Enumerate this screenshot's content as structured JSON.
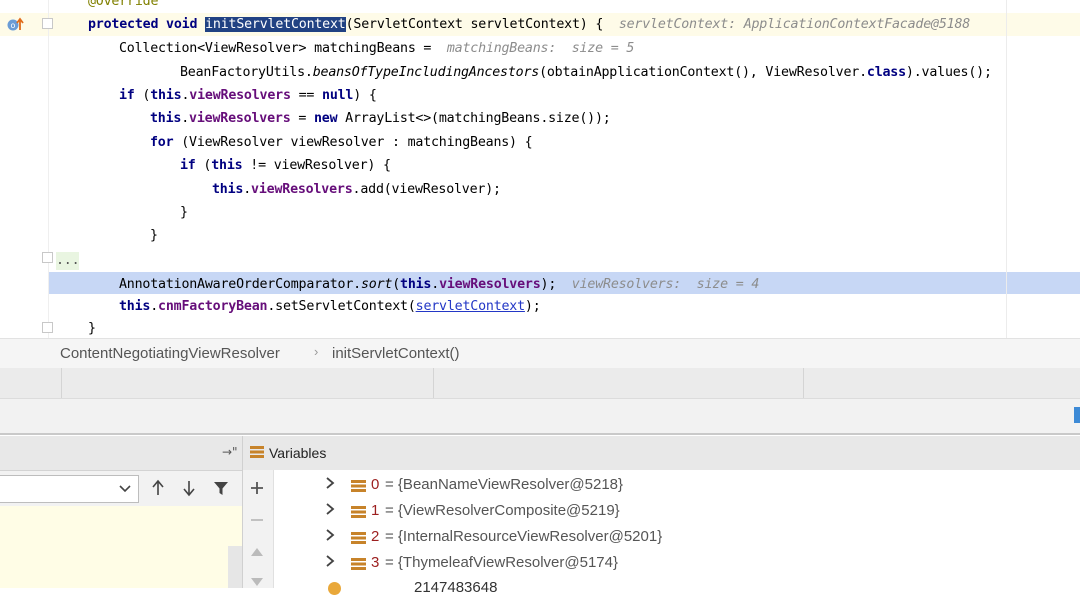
{
  "editor": {
    "lines": {
      "annotation": "@Override",
      "l1_kw": "protected void ",
      "l1_method": "initServletContext",
      "l1_rest": "(ServletContext servletContext) {",
      "l1_hint": "servletContext: ApplicationContextFacade@5188",
      "l2_a": "Collection",
      "l2_gen": "<ViewResolver>",
      "l2_b": " matchingBeans = ",
      "l2_hint": "matchingBeans:  size = 5",
      "l3_a": "BeanFactoryUtils.",
      "l3_method": "beansOfTypeIncludingAncestors",
      "l3_b": "(obtainApplicationContext(), ViewResolver.",
      "l3_kw": "class",
      "l3_c": ").values();",
      "l4_kw": "if",
      "l4_a": " (",
      "l4_this": "this",
      "l4_dot": ".",
      "l4_field": "viewResolvers",
      "l4_b": " == ",
      "l4_null": "null",
      "l4_c": ") {",
      "l5_this": "this",
      "l5_dot": ".",
      "l5_field": "viewResolvers",
      "l5_a": " = ",
      "l5_new": "new",
      "l5_b": " ArrayList<>(matchingBeans.size());",
      "l6_kw": "for",
      "l6_a": " (ViewResolver viewResolver : matchingBeans) {",
      "l7_kw": "if",
      "l7_a": " (",
      "l7_this": "this",
      "l7_b": " != viewResolver) {",
      "l8_this": "this",
      "l8_dot": ".",
      "l8_field": "viewResolvers",
      "l8_a": ".add(viewResolver);",
      "l9": "}",
      "l10": "}",
      "l11": "...",
      "l12_a": "AnnotationAwareOrderComparator.",
      "l12_method": "sort",
      "l12_b": "(",
      "l12_this": "this",
      "l12_dot": ".",
      "l12_field": "viewResolvers",
      "l12_c": ");",
      "l12_hint": "viewResolvers:  size = 4",
      "l13_this": "this",
      "l13_dot": ".",
      "l13_field": "cnmFactoryBean",
      "l13_a": ".setServletContext(",
      "l13_link": "servletContext",
      "l13_b": ");",
      "l14": "}"
    }
  },
  "breadcrumb": {
    "class_name": "ContentNegotiatingViewResolver",
    "separator": "›",
    "method_name": "initServletContext()"
  },
  "variables": {
    "title": "Variables",
    "items": [
      {
        "index": "0",
        "value": "= {BeanNameViewResolver@5218}"
      },
      {
        "index": "1",
        "value": "= {ViewResolverComposite@5219}"
      },
      {
        "index": "2",
        "value": "= {InternalResourceViewResolver@5201}"
      },
      {
        "index": "3",
        "value": "= {ThymeleafViewResolver@5174}"
      }
    ],
    "partial_row": "2147483648"
  },
  "colors": {
    "keyword": "#000080",
    "field": "#660e7a",
    "selection": "#214283",
    "execution_line": "#c7d7f5",
    "index": "#9c1f1f"
  }
}
